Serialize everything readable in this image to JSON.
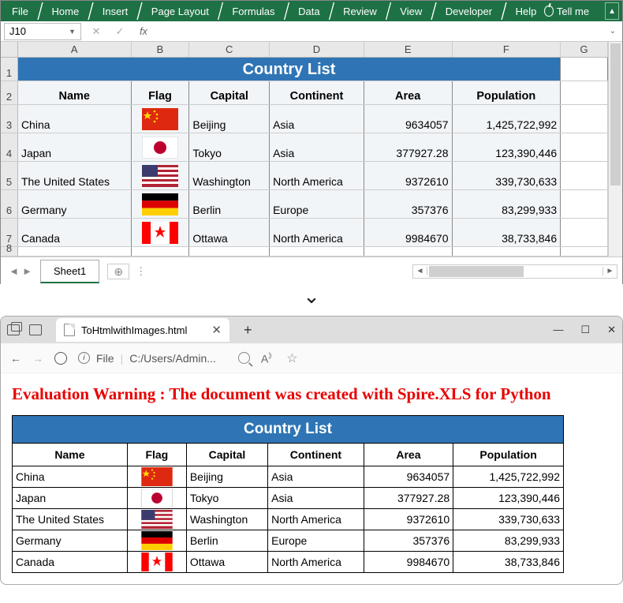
{
  "ribbon": {
    "tabs": [
      "File",
      "Home",
      "Insert",
      "Page Layout",
      "Formulas",
      "Data",
      "Review",
      "View",
      "Developer",
      "Help"
    ],
    "tellme": "Tell me",
    "collapse": "▲"
  },
  "namebox": "J10",
  "fx": "fx",
  "columns": [
    "A",
    "B",
    "C",
    "D",
    "E",
    "F",
    "G"
  ],
  "title": "Country List",
  "headers": [
    "Name",
    "Flag",
    "Capital",
    "Continent",
    "Area",
    "Population"
  ],
  "chart_data": {
    "type": "table",
    "columns": [
      "Name",
      "Flag",
      "Capital",
      "Continent",
      "Area",
      "Population"
    ],
    "rows": [
      {
        "name": "China",
        "flag": "cn",
        "capital": "Beijing",
        "continent": "Asia",
        "area": "9634057",
        "population": "1,425,722,992"
      },
      {
        "name": "Japan",
        "flag": "jp",
        "capital": "Tokyo",
        "continent": "Asia",
        "area": "377927.28",
        "population": "123,390,446"
      },
      {
        "name": "The United States",
        "flag": "us",
        "capital": "Washington",
        "continent": "North America",
        "area": "9372610",
        "population": "339,730,633"
      },
      {
        "name": "Germany",
        "flag": "de",
        "capital": "Berlin",
        "continent": "Europe",
        "area": "357376",
        "population": "83,299,933"
      },
      {
        "name": "Canada",
        "flag": "ca",
        "capital": "Ottawa",
        "continent": "North America",
        "area": "9984670",
        "population": "38,733,846"
      }
    ]
  },
  "sheet": "Sheet1",
  "browser": {
    "tab": "ToHtmlwithImages.html",
    "url_label": "File",
    "url_sep": "|",
    "url": "C:/Users/Admin...",
    "warning": "Evaluation Warning : The document was created with  Spire.XLS for Python"
  }
}
